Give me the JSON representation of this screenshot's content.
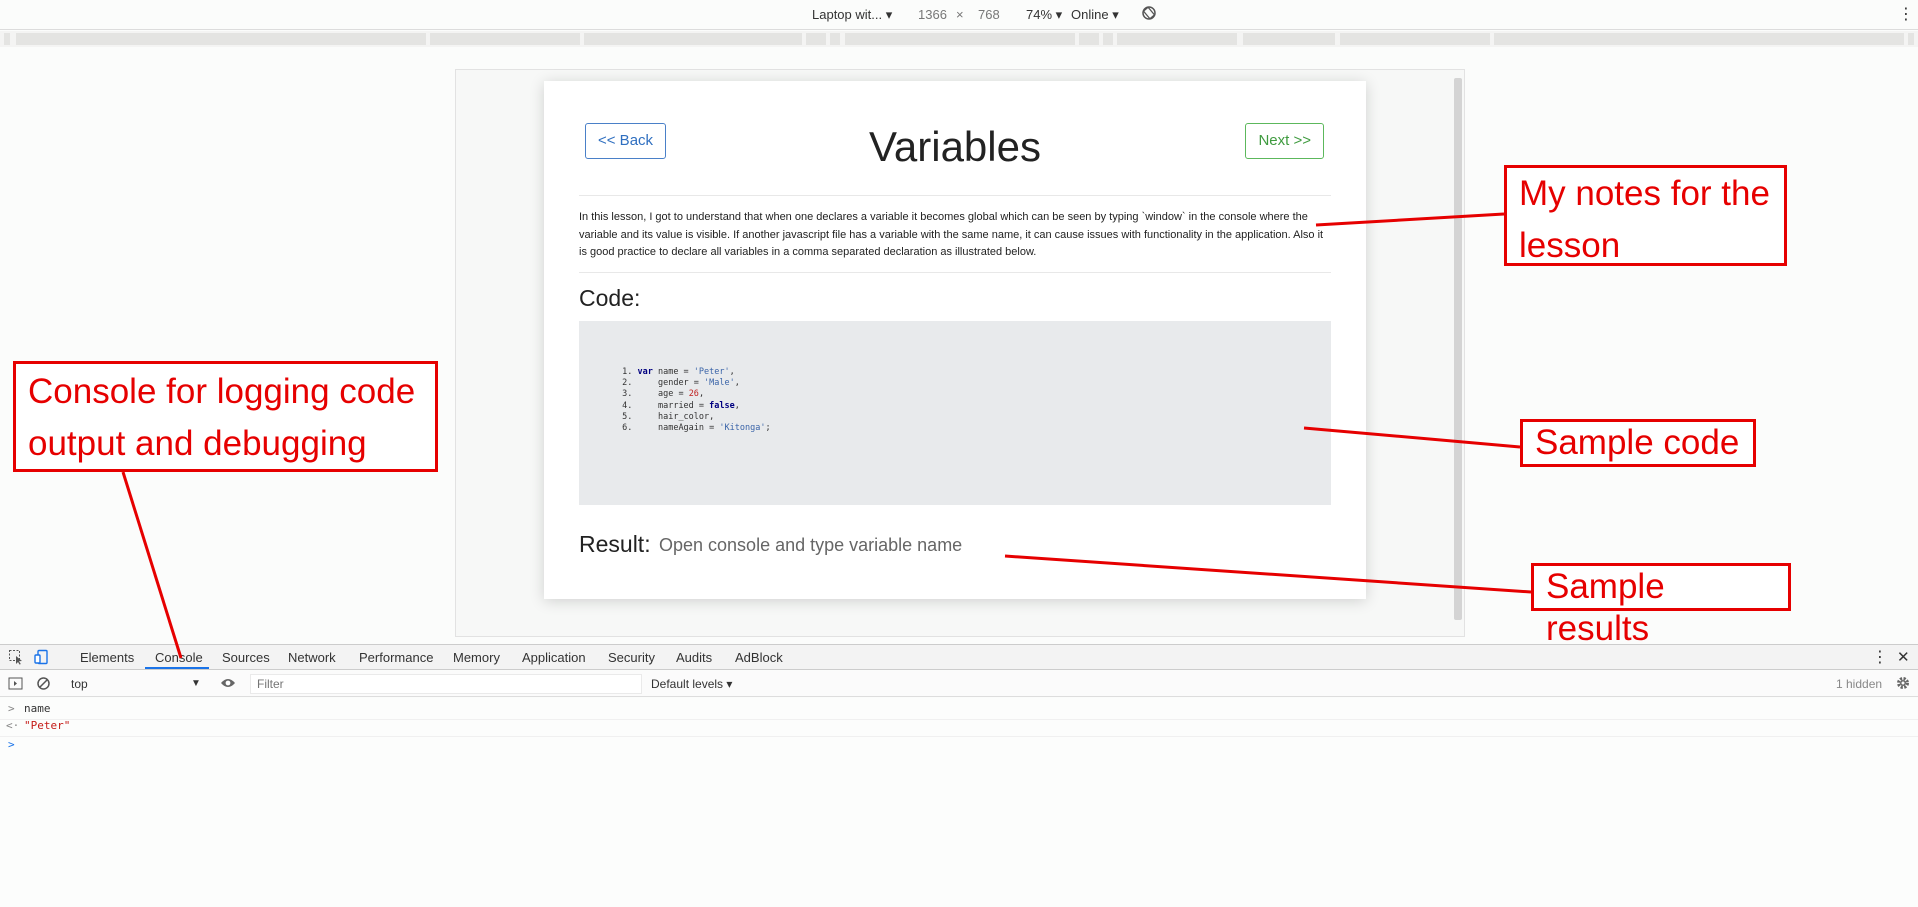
{
  "device_toolbar": {
    "device": "Laptop wit...",
    "width": "1366",
    "times": "×",
    "height": "768",
    "zoom": "74%",
    "network": "Online"
  },
  "lesson": {
    "back_label": "<< Back",
    "next_label": "Next >>",
    "title": "Variables",
    "notes": "In this lesson, I got to understand that when one declares a variable it becomes global which can be seen by typing `window` in the console where the variable and its value is visible. If another javascript file has a variable with the same name, it can cause issues with functionality in the application. Also it is good practice to declare all variables in a comma separated declaration as illustrated below.",
    "code_label": "Code:",
    "code_lines": [
      {
        "n": "1.",
        "pre": "",
        "kw": "var",
        "text": " name = ",
        "val": "'Peter'",
        "val_type": "str",
        "end": ","
      },
      {
        "n": "2.",
        "pre": "    ",
        "kw": "",
        "text": "gender = ",
        "val": "'Male'",
        "val_type": "str",
        "end": ","
      },
      {
        "n": "3.",
        "pre": "    ",
        "kw": "",
        "text": "age = ",
        "val": "26",
        "val_type": "num",
        "end": ","
      },
      {
        "n": "4.",
        "pre": "    ",
        "kw": "",
        "text": "married = ",
        "val": "false",
        "val_type": "kw",
        "end": ","
      },
      {
        "n": "5.",
        "pre": "    ",
        "kw": "",
        "text": "hair_color",
        "val": "",
        "val_type": "str",
        "end": ","
      },
      {
        "n": "6.",
        "pre": "    ",
        "kw": "",
        "text": "nameAgain = ",
        "val": "'Kitonga'",
        "val_type": "str",
        "end": ";"
      }
    ],
    "result_label": "Result:",
    "result_text": "Open console and type variable name"
  },
  "devtools": {
    "tabs": [
      "Elements",
      "Console",
      "Sources",
      "Network",
      "Performance",
      "Memory",
      "Application",
      "Security",
      "Audits",
      "AdBlock"
    ],
    "active_tab": "Console",
    "context": "top",
    "filter_placeholder": "Filter",
    "levels": "Default levels",
    "hidden": "1 hidden",
    "console_lines": [
      {
        "arrow": ">",
        "text": "name",
        "color": "#333333"
      },
      {
        "arrow": "<·",
        "text": "\"Peter\"",
        "color": "#c41a16"
      },
      {
        "arrow": ">",
        "text": "",
        "color": "#1a73e8"
      }
    ]
  },
  "annotations": {
    "notes": [
      "My notes for the",
      "lesson"
    ],
    "console": [
      "Console for logging code",
      "output and debugging"
    ],
    "sample_code": "Sample code",
    "sample_results": "Sample results",
    "color": "#e60000"
  }
}
